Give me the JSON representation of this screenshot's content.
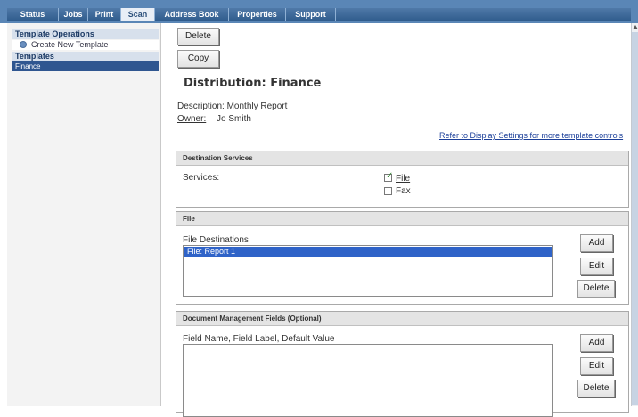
{
  "nav": {
    "tabs": [
      "Status",
      "Jobs",
      "Print",
      "Scan",
      "Address Book",
      "Properties",
      "Support"
    ]
  },
  "left": {
    "operations_header": "Template Operations",
    "create_template": "Create New Template",
    "templates_header": "Templates",
    "template_selected": "Finance"
  },
  "actions": {
    "delete": "Delete",
    "copy": "Copy"
  },
  "page": {
    "title": "Distribution: Finance",
    "description_label": "Description:",
    "description_value": "Monthly Report",
    "owner_label": "Owner:",
    "owner_value": "Jo Smith",
    "display_settings_link": "Refer to Display Settings for more template controls"
  },
  "destination": {
    "header": "Destination Services",
    "services_label": "Services:",
    "file_label": "File",
    "file_checked": true,
    "fax_label": "Fax",
    "fax_checked": false
  },
  "file_panel": {
    "header": "File",
    "list_label": "File Destinations",
    "items": [
      "File: Report 1"
    ],
    "add": "Add",
    "edit": "Edit",
    "delete": "Delete"
  },
  "docmgmt": {
    "header": "Document Management Fields (Optional)",
    "list_label": "Field Name, Field Label, Default Value",
    "add": "Add",
    "edit": "Edit",
    "delete": "Delete"
  },
  "colors": {
    "nav": "#2f5b8c",
    "selected": "#2f63c8",
    "link": "#1b3f99"
  }
}
